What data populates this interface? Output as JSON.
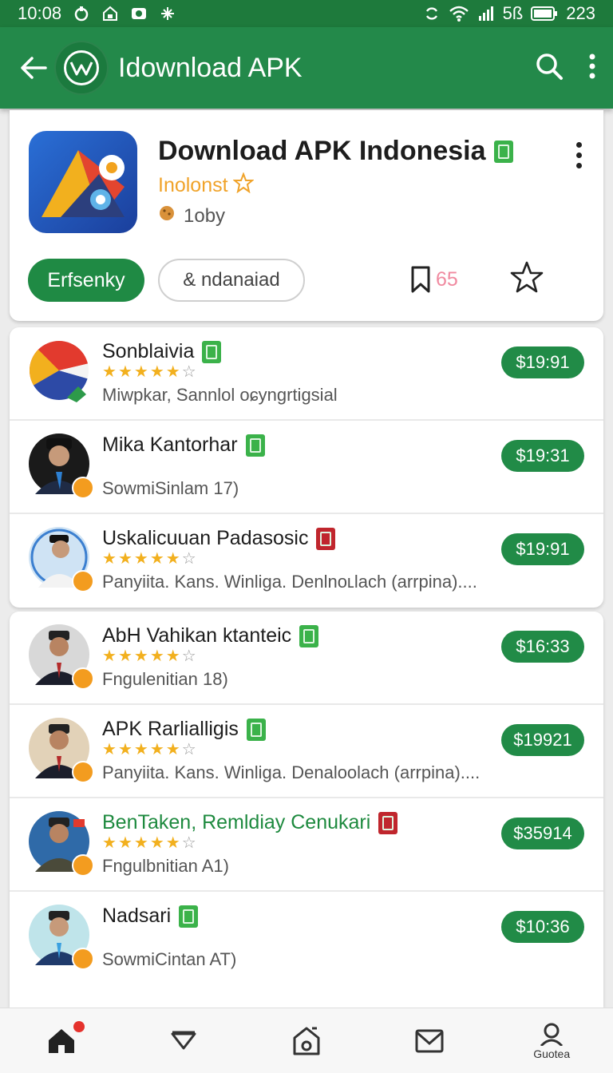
{
  "status_bar": {
    "time": "10:08",
    "battery_percent": "5ß",
    "battery_extra": "223"
  },
  "app_bar": {
    "title": "Idownload APK",
    "icons": [
      "back-arrow-icon",
      "logo-icon",
      "search-icon",
      "more-vert-icon"
    ]
  },
  "header": {
    "title": "Download APK Indonesia",
    "developer": "Inolonst",
    "meta": "1oby",
    "primary_button": "Erfsenky",
    "secondary_button": "& ndanaiad",
    "bookmark_count": "65"
  },
  "list_group_1": [
    {
      "name": "Sonblaivia",
      "rating": 4,
      "subtitle": "Miwpkar, Sannlol oɕyngrtigsial",
      "price": "$19:91",
      "name_color": "default",
      "badge": "green",
      "has_stars": true
    },
    {
      "name": "Mika Kantorhar",
      "rating": 0,
      "subtitle": "SowmiSinlam 17)",
      "price": "$19:31",
      "name_color": "default",
      "badge": "green",
      "has_stars": false
    },
    {
      "name": "Uskalicuuan Padasosic",
      "rating": 4,
      "subtitle": "Panyiita. Kans. Winliga. Denlnoʟlach (arrpina)....",
      "price": "$19:91",
      "name_color": "default",
      "badge": "red",
      "has_stars": true
    }
  ],
  "list_group_2": [
    {
      "name": "AbH Vahikan ktanteic",
      "rating": 4,
      "subtitle": "Fngulenitian 18)",
      "price": "$16:33",
      "name_color": "default",
      "badge": "green",
      "has_stars": true
    },
    {
      "name": "APK Rarlialligis",
      "rating": 4,
      "subtitle": "Panyiita. Kans. Winliga. Denaloolach (arrpina)....",
      "price": "$19921",
      "name_color": "default",
      "badge": "green",
      "has_stars": true
    },
    {
      "name": "BenTaken, Remldiay Cenukari",
      "rating": 4,
      "subtitle": "Fngulbnitian A1)",
      "price": "$35914",
      "name_color": "green",
      "badge": "red",
      "has_stars": true
    },
    {
      "name": "Nadsari",
      "rating": 0,
      "subtitle": "SowmiCintan AT)",
      "price": "$10:36",
      "name_color": "default",
      "badge": "green",
      "has_stars": false
    }
  ],
  "bottom_nav": [
    {
      "icon": "home-icon",
      "label": ""
    },
    {
      "icon": "chevron-down-icon",
      "label": ""
    },
    {
      "icon": "store-icon",
      "label": ""
    },
    {
      "icon": "mail-icon",
      "label": ""
    },
    {
      "icon": "profile-search-icon",
      "label": "Guotea"
    }
  ],
  "colors": {
    "primary_green": "#23894a",
    "status_bar": "#1e7a3c",
    "price_pill": "#218b47",
    "star": "#f2b01e",
    "developer_orange": "#f0a32a",
    "bookmark_pink": "#f08aa0"
  }
}
